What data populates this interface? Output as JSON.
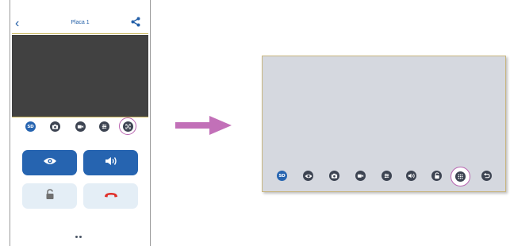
{
  "phone": {
    "header": {
      "title": "Placa 1",
      "back_icon": "chevron-left-icon",
      "share_icon": "share-icon"
    },
    "toolbar": {
      "sd_label": "SD",
      "icons": [
        "sd-icon",
        "camera-icon",
        "video-record-icon",
        "settings-sliders-icon",
        "fullscreen-icon"
      ],
      "highlighted": "fullscreen-icon"
    },
    "buttons": [
      {
        "name": "view-button",
        "icon": "eye-icon"
      },
      {
        "name": "audio-button",
        "icon": "speaker-icon"
      },
      {
        "name": "unlock-button",
        "icon": "padlock-icon"
      },
      {
        "name": "hangup-button",
        "icon": "phone-hangup-icon"
      }
    ]
  },
  "landscape": {
    "toolbar": {
      "sd_label": "SD",
      "icons": [
        "sd-icon",
        "eye-icon",
        "camera-icon",
        "video-record-icon",
        "settings-sliders-icon",
        "speaker-icon",
        "padlock-icon",
        "keypad-icon",
        "return-icon"
      ],
      "highlighted": "keypad-icon"
    }
  },
  "colors": {
    "accent_blue": "#2664b0",
    "highlight_ring": "#b865b0",
    "arrow": "#c270b8",
    "hangup_red": "#e0302a",
    "video_bg": "#414141",
    "landscape_bg": "#d5d8df"
  }
}
